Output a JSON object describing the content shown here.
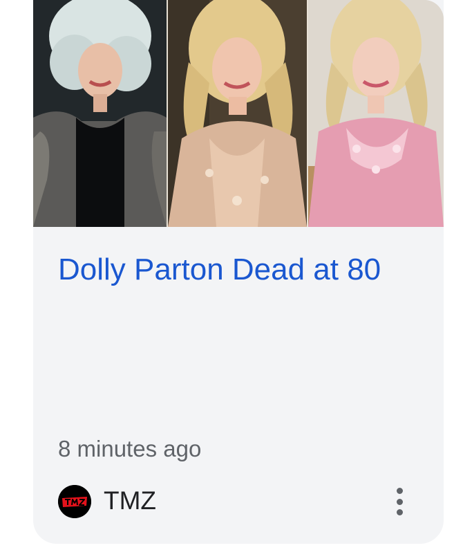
{
  "card": {
    "headline": "Dolly Parton Dead at 80",
    "time": "8 minutes ago",
    "source": {
      "name": "TMZ",
      "logo_text": "TMZ",
      "logo_icon": "tmz-logo-icon"
    },
    "thumbnail": {
      "panels": [
        "portrait-black-coat",
        "portrait-sequin-gold-dress",
        "portrait-pink-sequin-dress"
      ]
    },
    "more_icon": "more-vert-icon"
  },
  "colors": {
    "headline": "#1a57d0",
    "card_background": "#f3f4f6",
    "meta_text": "#5f6368",
    "logo_red": "#e3121b"
  }
}
